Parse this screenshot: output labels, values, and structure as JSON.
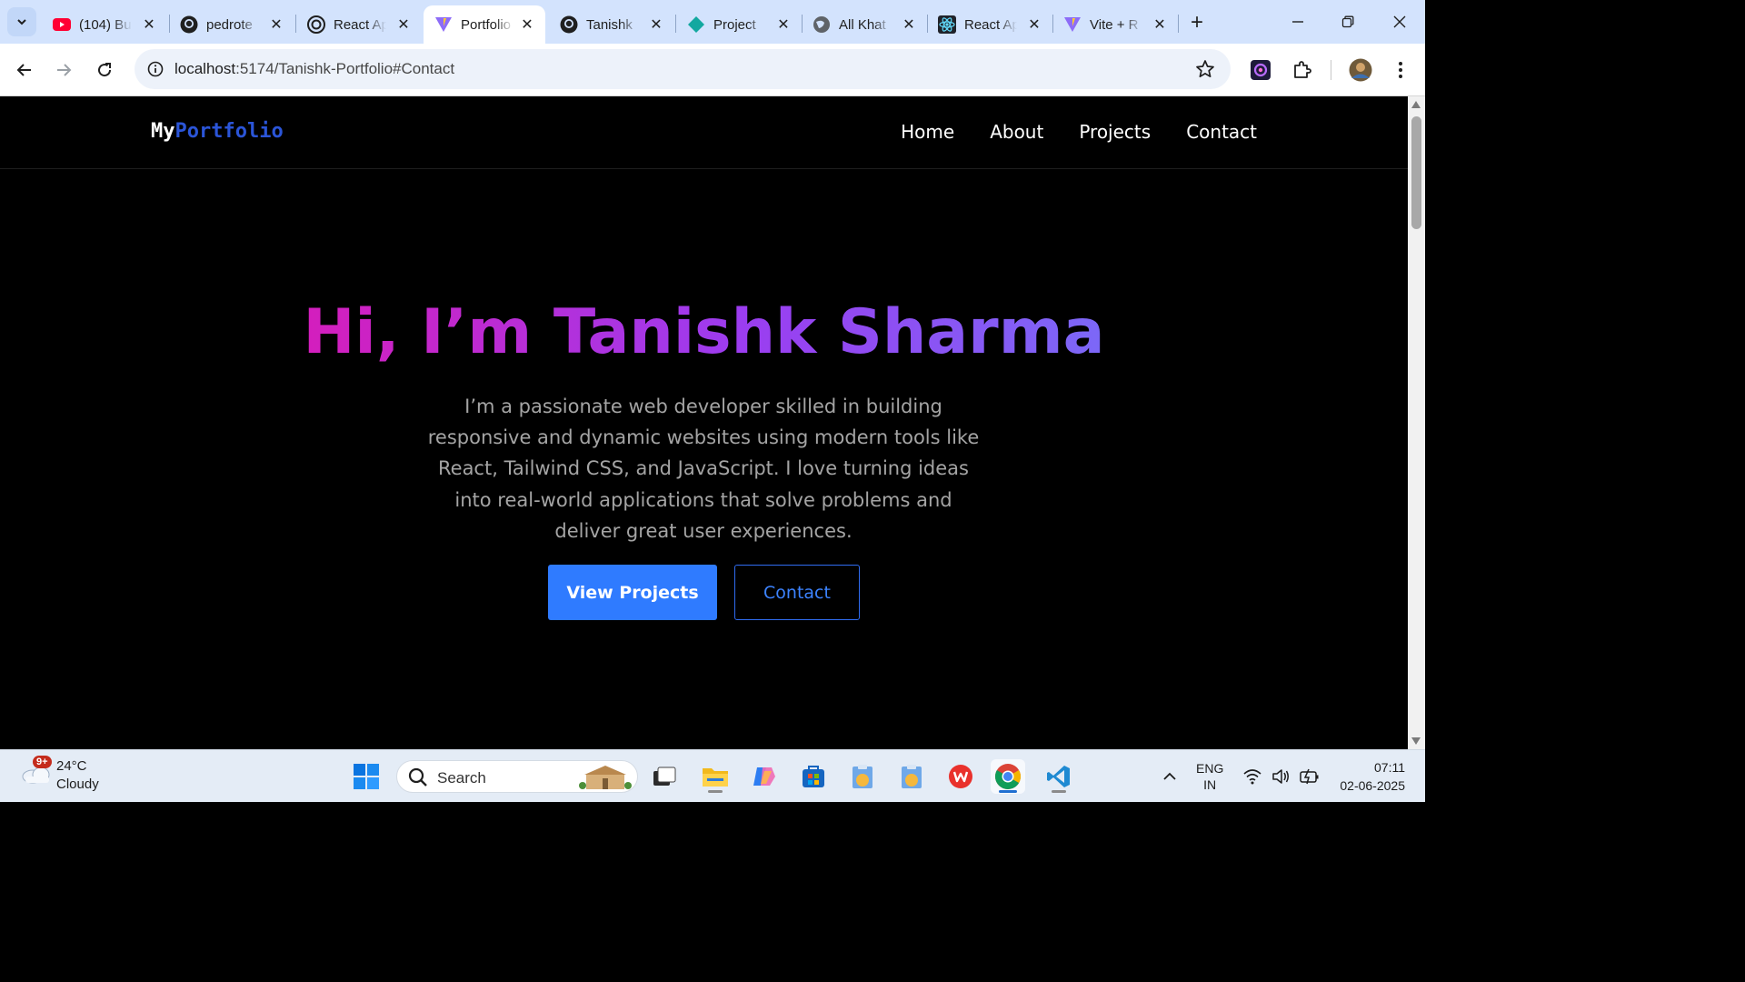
{
  "browser": {
    "tabs": [
      {
        "title": "(104) Bu",
        "icon": "youtube-icon",
        "active": false
      },
      {
        "title": "pedrote",
        "icon": "github-icon",
        "active": false
      },
      {
        "title": "React Ap",
        "icon": "openai-icon",
        "active": false
      },
      {
        "title": "Portfolio",
        "icon": "vite-icon",
        "active": true
      },
      {
        "title": "Tanishk",
        "icon": "github-icon",
        "active": false
      },
      {
        "title": "Project",
        "icon": "diamond-icon",
        "active": false
      },
      {
        "title": "All Khat",
        "icon": "globe-icon",
        "active": false
      },
      {
        "title": "React Ap",
        "icon": "react-icon",
        "active": false
      },
      {
        "title": "Vite + R",
        "icon": "vite-icon",
        "active": false
      }
    ],
    "url_host": "localhost",
    "url_rest": ":5174/Tanishk-Portfolio#Contact"
  },
  "site": {
    "logo_part1": "My",
    "logo_part2": "Portfolio",
    "nav": [
      {
        "label": "Home"
      },
      {
        "label": "About"
      },
      {
        "label": "Projects"
      },
      {
        "label": "Contact"
      }
    ],
    "hero": {
      "title": "Hi, I’m Tanishk Sharma",
      "lines": [
        "I’m a passionate web developer skilled in building",
        "responsive and dynamic websites using modern tools like",
        "React, Tailwind CSS, and JavaScript. I love turning ideas",
        "into real-world applications that solve problems and",
        "deliver great user experiences."
      ],
      "primary_button": "View Projects",
      "secondary_button": "Contact"
    },
    "colors": {
      "accent_blue": "#2f7bff",
      "gradient_start": "#d41ebd",
      "gradient_end": "#7c68f7"
    }
  },
  "taskbar": {
    "weather_temp": "24°C",
    "weather_condition": "Cloudy",
    "weather_badge": "9+",
    "search_label": "Search",
    "lang_line1": "ENG",
    "lang_line2": "IN",
    "time": "07:11",
    "date": "02-06-2025"
  }
}
